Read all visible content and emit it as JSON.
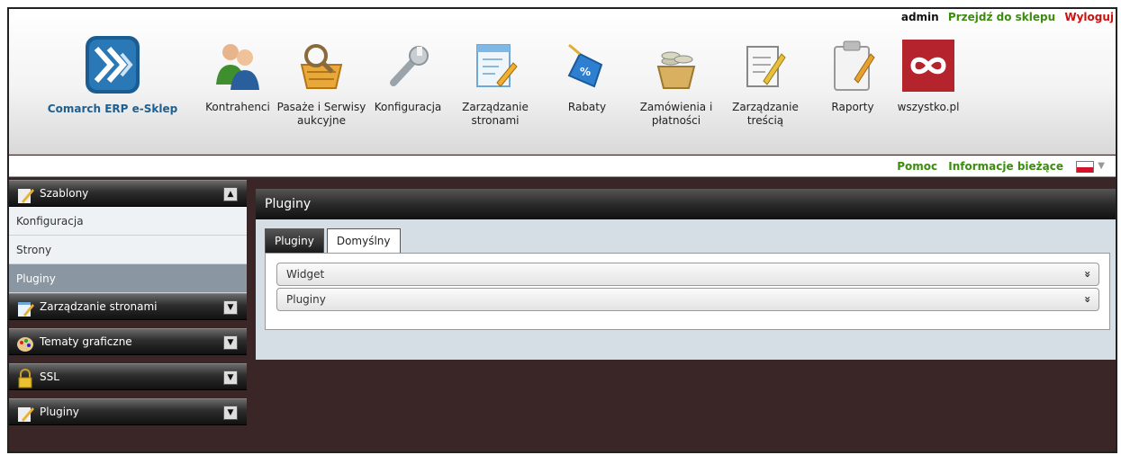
{
  "header": {
    "user": "admin",
    "store_link": "Przejdź do sklepu",
    "logout": "Wyloguj",
    "logo_caption": "Comarch ERP e-Sklep",
    "nav": [
      {
        "label": "Kontrahenci",
        "icon": "users-icon"
      },
      {
        "label": "Pasaże i Serwisy aukcyjne",
        "icon": "shopping-basket-icon"
      },
      {
        "label": "Konfiguracja",
        "icon": "wrench-icon"
      },
      {
        "label": "Zarządzanie stronami",
        "icon": "page-edit-icon"
      },
      {
        "label": "Rabaty",
        "icon": "price-tag-icon"
      },
      {
        "label": "Zamówienia i płatności",
        "icon": "coins-basket-icon"
      },
      {
        "label": "Zarządzanie treścią",
        "icon": "document-pencil-icon"
      },
      {
        "label": "Raporty",
        "icon": "clipboard-icon"
      },
      {
        "label": "wszystko.pl",
        "icon": "infinity-logo-icon"
      }
    ]
  },
  "infobar": {
    "help": "Pomoc",
    "news": "Informacje bieżące",
    "language": "pl-flag-icon"
  },
  "sidebar": {
    "sections": [
      {
        "title": "Szablony",
        "icon": "pencil-note-icon",
        "expanded": true,
        "items": [
          "Konfiguracja",
          "Strony",
          "Pluginy"
        ],
        "active_item": "Pluginy"
      },
      {
        "title": "Zarządzanie stronami",
        "icon": "page-edit-icon",
        "expanded": false
      },
      {
        "title": "Tematy graficzne",
        "icon": "palette-icon",
        "expanded": false
      },
      {
        "title": "SSL",
        "icon": "padlock-icon",
        "expanded": false
      },
      {
        "title": "Pluginy",
        "icon": "pencil-note-icon",
        "expanded": false
      }
    ]
  },
  "main": {
    "title": "Pluginy",
    "tabs": [
      {
        "label": "Pluginy",
        "selected": false
      },
      {
        "label": "Domyślny",
        "selected": true
      }
    ],
    "accordions": [
      "Widget",
      "Pluginy"
    ]
  },
  "colors": {
    "link_green": "#3c8c10",
    "logout_red": "#cc1111",
    "brand_blue": "#1f5f8f",
    "active_item": "#8a97a3"
  }
}
